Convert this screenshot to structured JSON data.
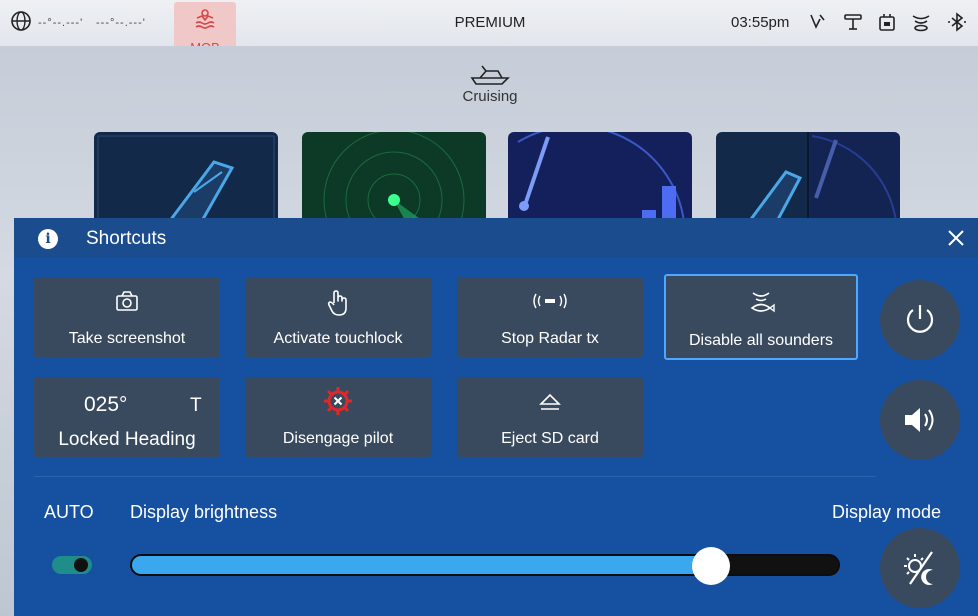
{
  "status_bar": {
    "lat": "--°--.---'",
    "lon": "---°--.---'",
    "mob_label": "MOB",
    "title": "PREMIUM",
    "time": "03:55pm",
    "icons": [
      "globe-icon",
      "sonar-status-icon",
      "radar-status-icon",
      "sd-card-status-icon",
      "sounder-status-icon",
      "bluetooth-icon"
    ]
  },
  "home": {
    "boat_mode": "Cruising",
    "tiles": [
      "navigation-app",
      "radar-app",
      "sonar-app",
      "combo-app"
    ]
  },
  "shortcuts": {
    "title": "Shortcuts",
    "tiles": [
      {
        "label": "Take screenshot",
        "icon": "camera-icon"
      },
      {
        "label": "Activate touchlock",
        "icon": "touch-icon"
      },
      {
        "label": "Stop Radar tx",
        "icon": "radar-tx-icon"
      },
      {
        "label": "Disable all sounders",
        "icon": "sounder-icon",
        "selected": true
      },
      {
        "label": "Disengage pilot",
        "icon": "autopilot-disengage-icon"
      },
      {
        "label": "Eject SD card",
        "icon": "eject-icon"
      }
    ],
    "heading": {
      "value": "025°",
      "reference": "T",
      "label": "Locked Heading"
    },
    "power_icon": "power-icon",
    "volume_icon": "volume-icon"
  },
  "brightness": {
    "auto_label": "AUTO",
    "label": "Display brightness",
    "mode_label": "Display mode",
    "auto_enabled": true,
    "level_percent": 82
  },
  "colors": {
    "panel": "#1650a0",
    "tile": "#3a4a5e",
    "accent": "#3aa8ee",
    "mob": "#d84848"
  }
}
